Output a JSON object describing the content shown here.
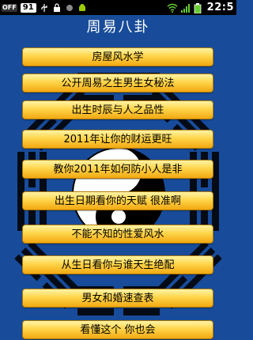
{
  "statusbar": {
    "off_label": "OFF",
    "notification_count": "91",
    "time": "22:5"
  },
  "app": {
    "title": "周易八卦"
  },
  "menu": {
    "items": [
      "房屋风水学",
      "公开周易之生男生女秘法",
      "出生时辰与人之品性",
      "2011年让你的财运更旺",
      "教你2011年如何防小人是非",
      "出生日期看你的天赋 很准啊",
      "不能不知的性爱风水",
      "从生日看你与谁天生绝配",
      "男女和婚速查表",
      "看懂这个 你也会"
    ]
  },
  "colors": {
    "background": "#184c9a",
    "button_gold": "#ffd54a"
  }
}
